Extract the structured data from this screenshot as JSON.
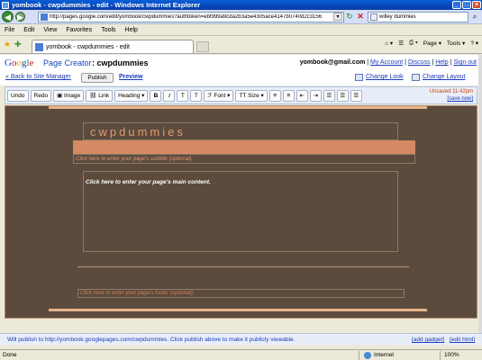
{
  "window": {
    "title": "yombook - cwpdummies - edit - Windows Internet Explorer"
  },
  "address_bar": {
    "url": "http://pages.google.com/edit/yombook/cwpdummies?authtoken=ebf999a9cda2b3a5e4305ace4147b0740d2c3156",
    "search_value": "willey dummies"
  },
  "menu": [
    "File",
    "Edit",
    "View",
    "Favorites",
    "Tools",
    "Help"
  ],
  "tab": {
    "label": "yombook - cwpdummies - edit"
  },
  "command_bar": {
    "page_label": "Page",
    "tools_label": "Tools"
  },
  "google_header": {
    "logo": [
      "G",
      "o",
      "o",
      "g",
      "l",
      "e"
    ],
    "product": "Page Creator",
    "site_name": ": cwpdummies",
    "email": "yombook@gmail.com",
    "links": [
      "My Account",
      "Discuss",
      "Help",
      "Sign out"
    ],
    "back_link": "« Back to Site Manager",
    "publish_button": "Publish",
    "preview_link": "Preview",
    "change_look": "Change Look",
    "change_layout": "Change Layout"
  },
  "toolbar": {
    "undo": "Undo",
    "redo": "Redo",
    "image": "Image",
    "link": "Link",
    "heading": "Heading",
    "bold": "B",
    "italic": "I",
    "font": "Font",
    "size": "Size",
    "unsaved": "Unsaved 11:42pm",
    "save_now": "[save now]"
  },
  "page": {
    "site_title": "cwpdummies",
    "subtitle_placeholder": "Click here to enter your page's subtitle (optional).",
    "main_placeholder": "Click here to enter your page's main content.",
    "footer_placeholder": "Click here to enter your page's footer (optional)."
  },
  "info_bar": {
    "message": "Will publish to http://yombook.googlepages.com/cwpdummies. Click publish above to make it publicly viewable.",
    "add_gadget": "[add gadget]",
    "edit_html": "[edit html]"
  },
  "status_bar": {
    "status": "Done",
    "zone": "Internet",
    "zoom": "100%"
  }
}
